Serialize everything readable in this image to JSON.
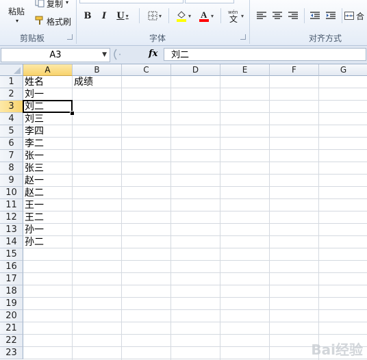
{
  "ribbon": {
    "clipboard": {
      "paste": "粘贴",
      "copy": "复制",
      "format_painter": "格式刷",
      "group_label": "剪贴板"
    },
    "font": {
      "bold": "B",
      "italic": "I",
      "underline": "U",
      "phonetic": "wén",
      "group_label": "字体",
      "fill_color": "#ffff00",
      "font_color": "#ff0000"
    },
    "alignment": {
      "group_label": "对齐方式",
      "merge": "合"
    }
  },
  "formula_bar": {
    "name_box": "A3",
    "fx": "fx",
    "content": "刘二"
  },
  "columns": [
    "A",
    "B",
    "C",
    "D",
    "E",
    "F",
    "G"
  ],
  "rows": [
    "1",
    "2",
    "3",
    "4",
    "5",
    "6",
    "7",
    "8",
    "9",
    "10",
    "11",
    "12",
    "13",
    "14",
    "15",
    "16",
    "17",
    "18",
    "19",
    "20",
    "21",
    "22",
    "23"
  ],
  "cells": {
    "A": [
      "姓名",
      "刘一",
      "刘二",
      "刘三",
      "李四",
      "李二",
      "张一",
      "张三",
      "赵一",
      "赵二",
      "王一",
      "王二",
      "孙一",
      "孙二"
    ],
    "B": [
      "成绩"
    ]
  },
  "selection": {
    "column": "A",
    "row": "3"
  },
  "watermark": "Bai经验"
}
